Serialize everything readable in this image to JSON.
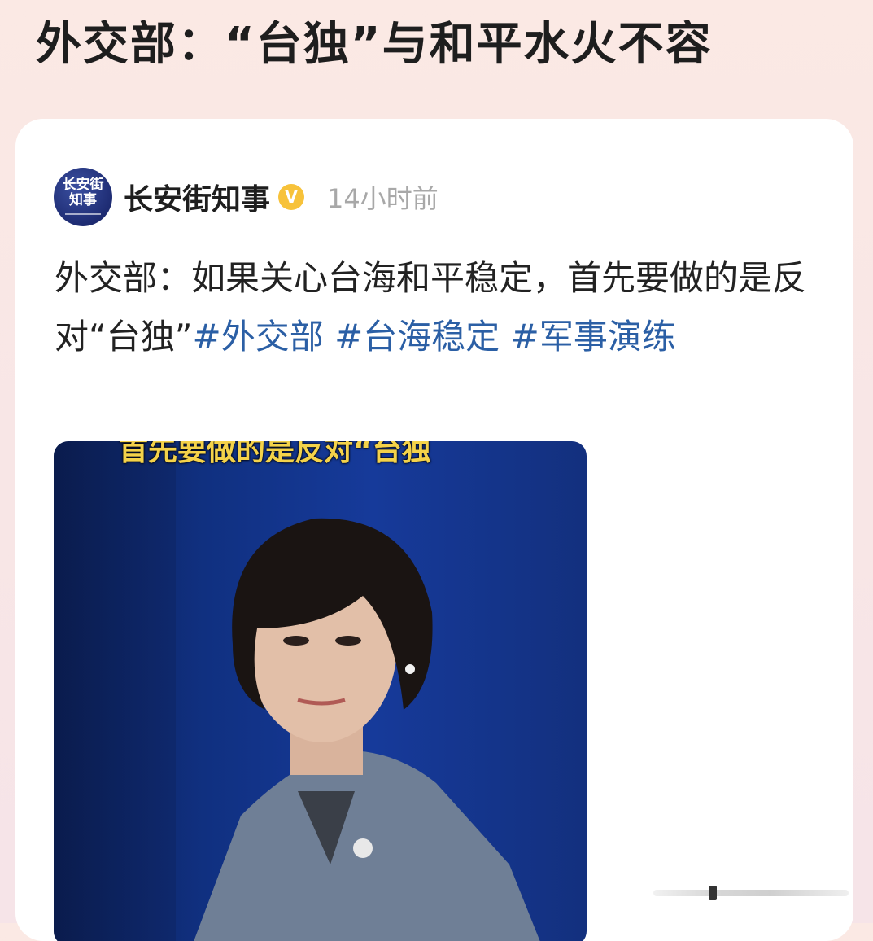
{
  "page": {
    "title": "外交部：“台独”与和平水火不容"
  },
  "post": {
    "avatar_text": "长安街\n知事",
    "author": "长安街知事",
    "verified_mark": "V",
    "time": "14小时前",
    "text_part1": "外交部：如果关心台海和平稳定，首先要做的是反对“台独”",
    "hashtags": [
      "#外交部",
      "#台海稳定",
      "#军事演练"
    ]
  },
  "image": {
    "caption": "首先要做的是反对“台独",
    "description_icon": "person-photo-icon"
  },
  "colors": {
    "hashtag": "#2b5fa5",
    "verified": "#f7c23a",
    "time": "#a8a8a8"
  }
}
